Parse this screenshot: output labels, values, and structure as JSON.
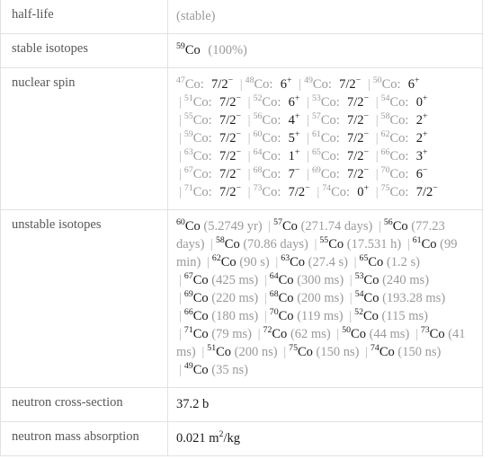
{
  "table": {
    "rows": [
      {
        "label": "half-life",
        "kind": "plain-muted",
        "value": "(stable)"
      },
      {
        "label": "stable isotopes",
        "kind": "stable",
        "isotope": {
          "mass": "59",
          "element": "Co"
        },
        "abundance": "(100%)"
      },
      {
        "label": "nuclear spin",
        "kind": "spins"
      },
      {
        "label": "unstable isotopes",
        "kind": "halflives"
      },
      {
        "label": "neutron cross-section",
        "kind": "plain",
        "value": "37.2 b"
      },
      {
        "label": "neutron mass absorption",
        "kind": "m2kg",
        "value_before": "0.021 m",
        "value_sup": "2",
        "value_after": "/kg"
      }
    ]
  },
  "element_symbol": "Co",
  "nuclear_spin": [
    {
      "mass": "47",
      "element": "Co",
      "spin": "7/2",
      "sign": "−"
    },
    {
      "mass": "48",
      "element": "Co",
      "spin": "6",
      "sign": "+"
    },
    {
      "mass": "49",
      "element": "Co",
      "spin": "7/2",
      "sign": "−"
    },
    {
      "mass": "50",
      "element": "Co",
      "spin": "6",
      "sign": "+"
    },
    {
      "mass": "51",
      "element": "Co",
      "spin": "7/2",
      "sign": "−"
    },
    {
      "mass": "52",
      "element": "Co",
      "spin": "6",
      "sign": "+"
    },
    {
      "mass": "53",
      "element": "Co",
      "spin": "7/2",
      "sign": "−"
    },
    {
      "mass": "54",
      "element": "Co",
      "spin": "0",
      "sign": "+"
    },
    {
      "mass": "55",
      "element": "Co",
      "spin": "7/2",
      "sign": "−"
    },
    {
      "mass": "56",
      "element": "Co",
      "spin": "4",
      "sign": "+"
    },
    {
      "mass": "57",
      "element": "Co",
      "spin": "7/2",
      "sign": "−"
    },
    {
      "mass": "58",
      "element": "Co",
      "spin": "2",
      "sign": "+"
    },
    {
      "mass": "59",
      "element": "Co",
      "spin": "7/2",
      "sign": "−"
    },
    {
      "mass": "60",
      "element": "Co",
      "spin": "5",
      "sign": "+"
    },
    {
      "mass": "61",
      "element": "Co",
      "spin": "7/2",
      "sign": "−"
    },
    {
      "mass": "62",
      "element": "Co",
      "spin": "2",
      "sign": "+"
    },
    {
      "mass": "63",
      "element": "Co",
      "spin": "7/2",
      "sign": "−"
    },
    {
      "mass": "64",
      "element": "Co",
      "spin": "1",
      "sign": "+"
    },
    {
      "mass": "65",
      "element": "Co",
      "spin": "7/2",
      "sign": "−"
    },
    {
      "mass": "66",
      "element": "Co",
      "spin": "3",
      "sign": "+"
    },
    {
      "mass": "67",
      "element": "Co",
      "spin": "7/2",
      "sign": "−"
    },
    {
      "mass": "68",
      "element": "Co",
      "spin": "7",
      "sign": "−"
    },
    {
      "mass": "69",
      "element": "Co",
      "spin": "7/2",
      "sign": "−"
    },
    {
      "mass": "70",
      "element": "Co",
      "spin": "6",
      "sign": "−"
    },
    {
      "mass": "71",
      "element": "Co",
      "spin": "7/2",
      "sign": "−"
    },
    {
      "mass": "73",
      "element": "Co",
      "spin": "7/2",
      "sign": "−"
    },
    {
      "mass": "74",
      "element": "Co",
      "spin": "0",
      "sign": "+"
    },
    {
      "mass": "75",
      "element": "Co",
      "spin": "7/2",
      "sign": "−"
    }
  ],
  "unstable_isotopes": [
    {
      "mass": "60",
      "element": "Co",
      "halflife": "(5.2749 yr)"
    },
    {
      "mass": "57",
      "element": "Co",
      "halflife": "(271.74 days)"
    },
    {
      "mass": "56",
      "element": "Co",
      "halflife": "(77.23 days)"
    },
    {
      "mass": "58",
      "element": "Co",
      "halflife": "(70.86 days)"
    },
    {
      "mass": "55",
      "element": "Co",
      "halflife": "(17.531 h)"
    },
    {
      "mass": "61",
      "element": "Co",
      "halflife": "(99 min)"
    },
    {
      "mass": "62",
      "element": "Co",
      "halflife": "(90 s)"
    },
    {
      "mass": "63",
      "element": "Co",
      "halflife": "(27.4 s)"
    },
    {
      "mass": "65",
      "element": "Co",
      "halflife": "(1.2 s)"
    },
    {
      "mass": "67",
      "element": "Co",
      "halflife": "(425 ms)"
    },
    {
      "mass": "64",
      "element": "Co",
      "halflife": "(300 ms)"
    },
    {
      "mass": "53",
      "element": "Co",
      "halflife": "(240 ms)"
    },
    {
      "mass": "69",
      "element": "Co",
      "halflife": "(220 ms)"
    },
    {
      "mass": "68",
      "element": "Co",
      "halflife": "(200 ms)"
    },
    {
      "mass": "54",
      "element": "Co",
      "halflife": "(193.28 ms)"
    },
    {
      "mass": "66",
      "element": "Co",
      "halflife": "(180 ms)"
    },
    {
      "mass": "70",
      "element": "Co",
      "halflife": "(119 ms)"
    },
    {
      "mass": "52",
      "element": "Co",
      "halflife": "(115 ms)"
    },
    {
      "mass": "71",
      "element": "Co",
      "halflife": "(79 ms)"
    },
    {
      "mass": "72",
      "element": "Co",
      "halflife": "(62 ms)"
    },
    {
      "mass": "50",
      "element": "Co",
      "halflife": "(44 ms)"
    },
    {
      "mass": "73",
      "element": "Co",
      "halflife": "(41 ms)"
    },
    {
      "mass": "51",
      "element": "Co",
      "halflife": "(200 ns)"
    },
    {
      "mass": "75",
      "element": "Co",
      "halflife": "(150 ns)"
    },
    {
      "mass": "74",
      "element": "Co",
      "halflife": "(150 ns)"
    },
    {
      "mass": "49",
      "element": "Co",
      "halflife": "(35 ns)"
    }
  ],
  "colors": {
    "border": "#e2e2e2",
    "label_text": "#58585a",
    "muted_text": "#9a9a9c",
    "primary_text": "#1a1a1a"
  }
}
